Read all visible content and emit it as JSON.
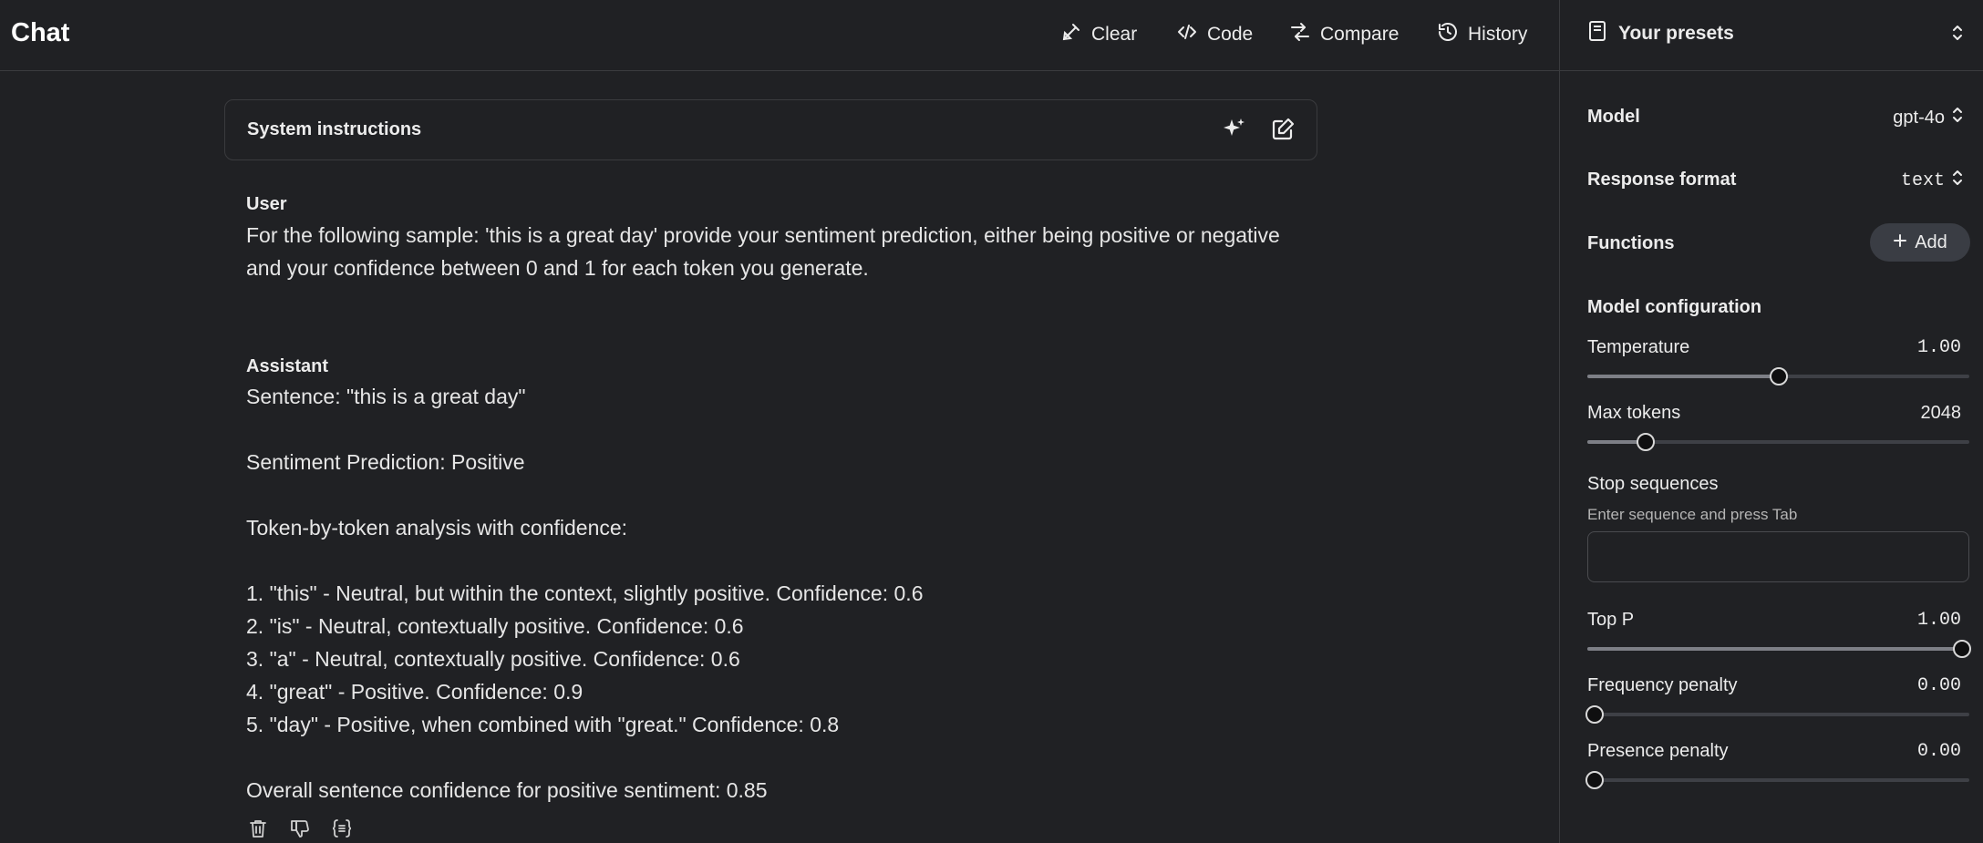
{
  "header": {
    "title": "Chat",
    "actions": [
      {
        "label": "Clear",
        "icon": "broom-icon"
      },
      {
        "label": "Code",
        "icon": "code-icon"
      },
      {
        "label": "Compare",
        "icon": "compare-arrows-icon"
      },
      {
        "label": "History",
        "icon": "history-icon"
      }
    ],
    "presets_label": "Your presets"
  },
  "system": {
    "label": "System instructions"
  },
  "messages": {
    "user_role": "User",
    "user_text": "For the following sample: 'this is a great day' provide your sentiment prediction, either being positive or negative and your confidence between 0 and 1 for each token you generate.",
    "assistant_role": "Assistant",
    "assistant_lines": [
      "Sentence: \"this is a great day\"",
      "Sentiment Prediction: Positive",
      "Token-by-token analysis with confidence:",
      "1. \"this\" - Neutral, but within the context, slightly positive. Confidence: 0.6",
      "2. \"is\" - Neutral, contextually positive. Confidence: 0.6",
      "3. \"a\" - Neutral, contextually positive. Confidence: 0.6",
      "4. \"great\" - Positive. Confidence: 0.9",
      "5. \"day\" - Positive, when combined with \"great.\" Confidence: 0.8",
      "Overall sentence confidence for positive sentiment: 0.85"
    ]
  },
  "sidebar": {
    "model_label": "Model",
    "model_value": "gpt-4o",
    "response_format_label": "Response format",
    "response_format_value": "text",
    "functions_label": "Functions",
    "add_label": "Add",
    "config_label": "Model configuration",
    "temperature_label": "Temperature",
    "temperature_value": "1.00",
    "temperature_fraction": 0.5,
    "max_tokens_label": "Max tokens",
    "max_tokens_value": "2048",
    "max_tokens_fraction": 0.14,
    "stop_label": "Stop sequences",
    "stop_hint": "Enter sequence and press Tab",
    "top_p_label": "Top P",
    "top_p_value": "1.00",
    "top_p_fraction": 1.0,
    "freq_label": "Frequency penalty",
    "freq_value": "0.00",
    "freq_fraction": 0.0,
    "presence_label": "Presence penalty",
    "presence_value": "0.00",
    "presence_fraction": 0.0
  }
}
